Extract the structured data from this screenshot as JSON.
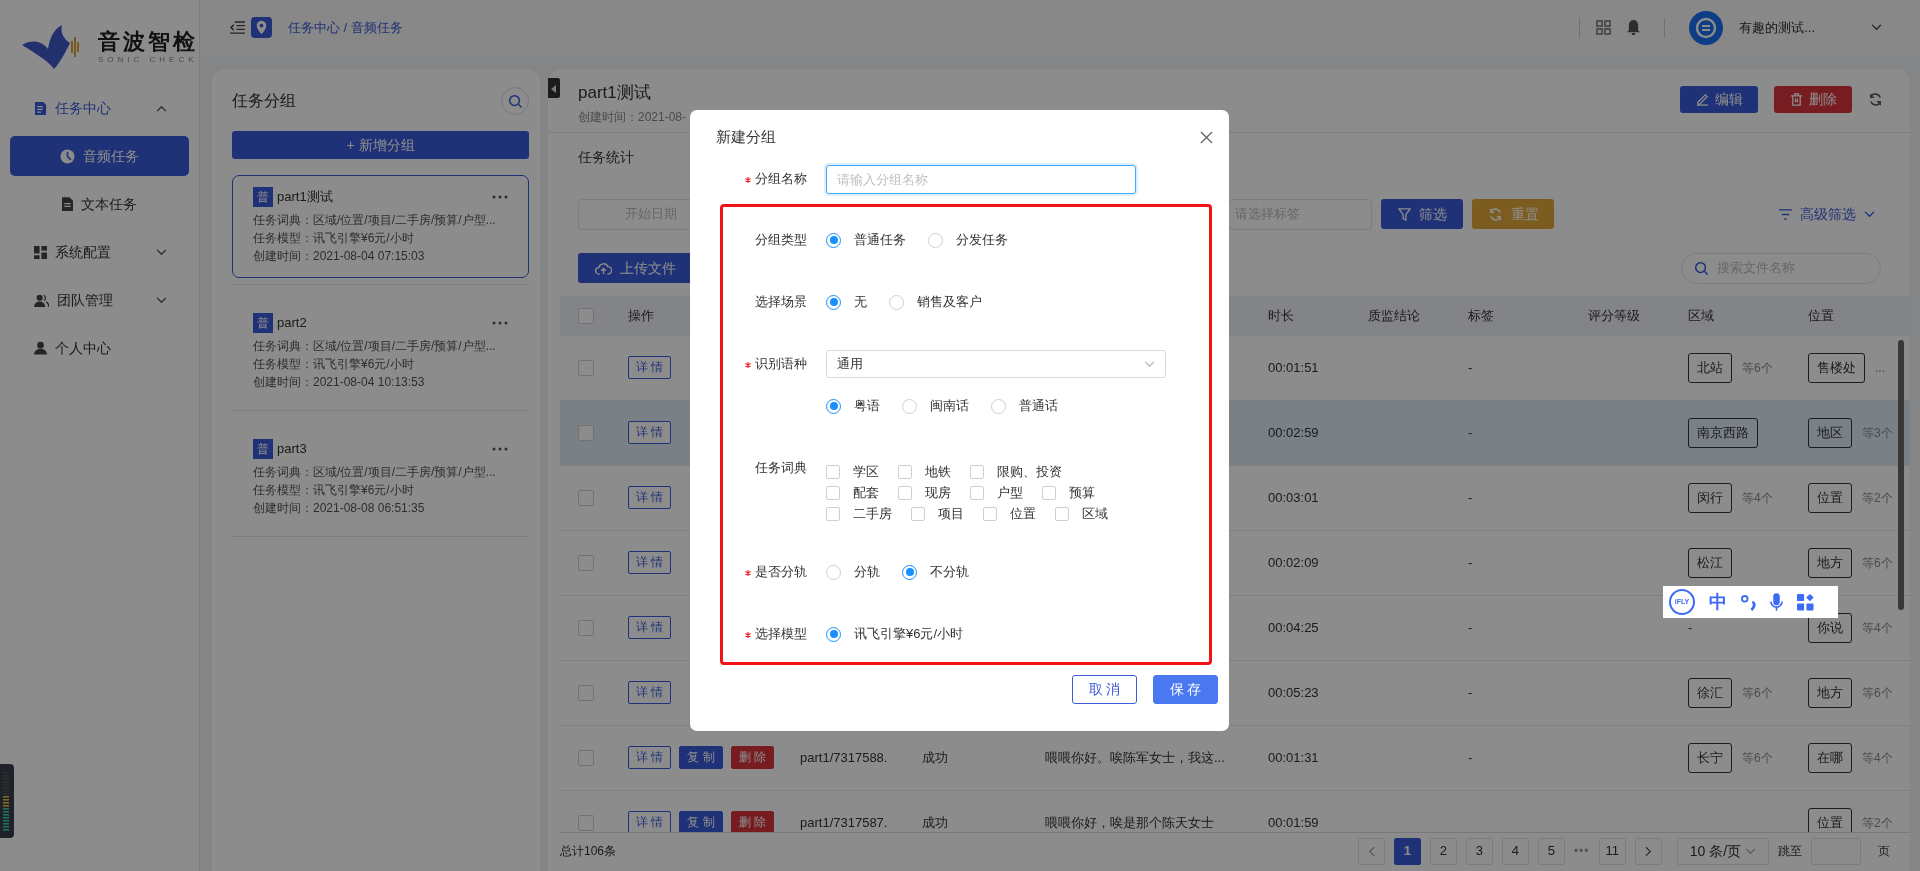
{
  "sidebar": {
    "logo": {
      "name": "音波智检",
      "tagline": "SONIC CHECK"
    },
    "items": [
      {
        "label": "任务中心",
        "kind": "group",
        "expanded": true,
        "children": [
          {
            "label": "音频任务",
            "selected": true
          },
          {
            "label": "文本任务",
            "selected": false
          }
        ]
      },
      {
        "label": "系统配置",
        "kind": "group",
        "expanded": false
      },
      {
        "label": "团队管理",
        "kind": "group",
        "expanded": false
      },
      {
        "label": "个人中心",
        "kind": "link"
      }
    ]
  },
  "header": {
    "breadcrumb": "任务中心 / 音频任务",
    "user": {
      "name": "有趣的测试..."
    }
  },
  "group_panel": {
    "title": "任务分组",
    "add_button": "+ 新增分组",
    "groups": [
      {
        "badge": "普",
        "name": "part1测试",
        "selected": true,
        "lines": [
          "任务词典：区域/位置/项目/二手房/预算/户型...",
          "任务模型：讯飞引擎¥6元/小时",
          "创建时间：2021-08-04 07:15:03"
        ]
      },
      {
        "badge": "普",
        "name": "part2",
        "selected": false,
        "lines": [
          "任务词典：区域/位置/项目/二手房/预算/户型...",
          "任务模型：讯飞引擎¥6元/小时",
          "创建时间：2021-08-04 10:13:53"
        ]
      },
      {
        "badge": "普",
        "name": "part3",
        "selected": false,
        "lines": [
          "任务词典：区域/位置/项目/二手房/预算/户型...",
          "任务模型：讯飞引擎¥6元/小时",
          "创建时间：2021-08-08 06:51:35"
        ]
      }
    ]
  },
  "task": {
    "title": "part1测试",
    "created": "创建时间：2021-08-",
    "actions": [
      {
        "label": "编辑",
        "kind": "edit"
      },
      {
        "label": "删除",
        "kind": "delete"
      }
    ],
    "section": "任务统计"
  },
  "filters": {
    "start_date": {
      "placeholder": "开始日期"
    },
    "tag_select": {
      "placeholder": "请选择标签"
    },
    "buttons": [
      {
        "label": "筛选",
        "kind": "filter"
      },
      {
        "label": "重置",
        "kind": "reset"
      }
    ],
    "advanced": "高级筛选"
  },
  "upload_button": "上传文件",
  "file_search": {
    "placeholder": "搜索文件名称"
  },
  "table": {
    "select_all": {
      "checked": false
    },
    "columns": [
      "操作",
      "时长",
      "质监结论",
      "标签",
      "评分等级",
      "区域",
      "位置"
    ],
    "rows": [
      {
        "selected": false,
        "checked": false,
        "actions": [
          {
            "label": "详 情",
            "kind": "detail"
          }
        ],
        "duration": "00:01:51",
        "tag": "-",
        "region": {
          "tag": "北站",
          "more": "等6个"
        },
        "location": {
          "tag": "售楼处",
          "more": "..."
        }
      },
      {
        "selected": true,
        "checked": false,
        "actions": [
          {
            "label": "详 情",
            "kind": "detail"
          }
        ],
        "duration": "00:02:59",
        "tag": "-",
        "region": {
          "tag": "南京西路"
        },
        "location": {
          "tag": "地区",
          "more": "等3个"
        }
      },
      {
        "selected": false,
        "checked": false,
        "actions": [
          {
            "label": "详 情",
            "kind": "detail"
          }
        ],
        "duration": "00:03:01",
        "tag": "-",
        "region": {
          "tag": "闵行",
          "more": "等4个"
        },
        "location": {
          "tag": "位置",
          "more": "等2个"
        }
      },
      {
        "selected": false,
        "checked": false,
        "actions": [
          {
            "label": "详 情",
            "kind": "detail"
          }
        ],
        "duration": "00:02:09",
        "tag": "-",
        "region": {
          "tag": "松江"
        },
        "location": {
          "tag": "地方",
          "more": "等6个"
        }
      },
      {
        "selected": false,
        "checked": false,
        "actions": [
          {
            "label": "详 情",
            "kind": "detail"
          }
        ],
        "duration": "00:04:25",
        "tag": "-",
        "region": {
          "text": "-"
        },
        "location": {
          "tag": "你说",
          "more": "等4个"
        }
      },
      {
        "selected": false,
        "checked": false,
        "actions": [
          {
            "label": "详 情",
            "kind": "detail"
          }
        ],
        "duration": "00:05:23",
        "tag": "-",
        "region": {
          "tag": "徐汇",
          "more": "等6个"
        },
        "location": {
          "tag": "地方",
          "more": "等6个"
        }
      },
      {
        "selected": false,
        "checked": false,
        "actions": [
          {
            "label": "详 情",
            "kind": "detail"
          },
          {
            "label": "复 制",
            "kind": "copy"
          },
          {
            "label": "删 除",
            "kind": "delete"
          }
        ],
        "file": "part1/7317588.",
        "status": "成功",
        "content": "喂喂你好。唉陈军女士，我这...",
        "duration": "00:01:31",
        "tag": "-",
        "region": {
          "tag": "长宁",
          "more": "等6个"
        },
        "location": {
          "tag": "在哪",
          "more": "等4个"
        }
      },
      {
        "selected": false,
        "checked": false,
        "actions": [
          {
            "label": "详 情",
            "kind": "detail"
          },
          {
            "label": "复 制",
            "kind": "copy"
          },
          {
            "label": "删 除",
            "kind": "delete"
          }
        ],
        "file": "part1/7317587.",
        "status": "成功",
        "content": "喂喂你好，唉是那个陈天女士",
        "duration": "00:01:59",
        "location": {
          "tag": "位置",
          "more": "等2个"
        }
      }
    ]
  },
  "pagination": {
    "total": "总计106条",
    "pages": [
      {
        "label": "1",
        "kind": "page",
        "selected": true
      },
      {
        "label": "2",
        "kind": "page",
        "selected": false
      },
      {
        "label": "3",
        "kind": "page",
        "selected": false
      },
      {
        "label": "4",
        "kind": "page",
        "selected": false
      },
      {
        "label": "5",
        "kind": "page",
        "selected": false
      },
      {
        "label": "•••",
        "kind": "ellipsis"
      },
      {
        "label": "11",
        "kind": "page",
        "selected": false
      }
    ],
    "page_size": "10 条/页",
    "jump_label": "跳至",
    "page_suffix": "页"
  },
  "ime_toolbar": {
    "logo": "iFLY",
    "mode": "中"
  },
  "modal": {
    "title": "新建分组",
    "fields": [
      {
        "label": "分组名称",
        "required": true,
        "kind": "text",
        "placeholder": "请输入分组名称"
      }
    ],
    "highlighted_fields": [
      {
        "label": "分组类型",
        "required": false,
        "kind": "radio",
        "options": [
          {
            "label": "普通任务",
            "selected": true
          },
          {
            "label": "分发任务",
            "selected": false
          }
        ]
      },
      {
        "label": "选择场景",
        "required": false,
        "kind": "radio",
        "options": [
          {
            "label": "无",
            "selected": true
          },
          {
            "label": "销售及客户",
            "selected": false
          }
        ]
      },
      {
        "label": "识别语种",
        "required": true,
        "kind": "select",
        "value": "通用",
        "options": [
          {
            "label": "粤语",
            "selected": true
          },
          {
            "label": "闽南话",
            "selected": false
          },
          {
            "label": "普通话",
            "selected": false
          }
        ]
      },
      {
        "label": "任务词典",
        "required": false,
        "kind": "checkbox",
        "options": [
          {
            "label": "学区",
            "checked": false
          },
          {
            "label": "地铁",
            "checked": false
          },
          {
            "label": "限购、投资",
            "checked": false
          },
          {
            "label": "配套",
            "checked": false
          },
          {
            "label": "现房",
            "checked": false
          },
          {
            "label": "户型",
            "checked": false
          },
          {
            "label": "预算",
            "checked": false
          },
          {
            "label": "二手房",
            "checked": false
          },
          {
            "label": "项目",
            "checked": false
          },
          {
            "label": "位置",
            "checked": false
          },
          {
            "label": "区域",
            "checked": false
          }
        ]
      },
      {
        "label": "是否分轨",
        "required": true,
        "kind": "radio",
        "options": [
          {
            "label": "分轨",
            "selected": false
          },
          {
            "label": "不分轨",
            "selected": true
          }
        ]
      },
      {
        "label": "选择模型",
        "required": true,
        "kind": "radio",
        "options": [
          {
            "label": "讯飞引擎¥6元/小时",
            "selected": true
          }
        ]
      }
    ],
    "buttons": [
      {
        "label": "取 消",
        "kind": "cancel"
      },
      {
        "label": "保 存",
        "kind": "save"
      }
    ]
  }
}
